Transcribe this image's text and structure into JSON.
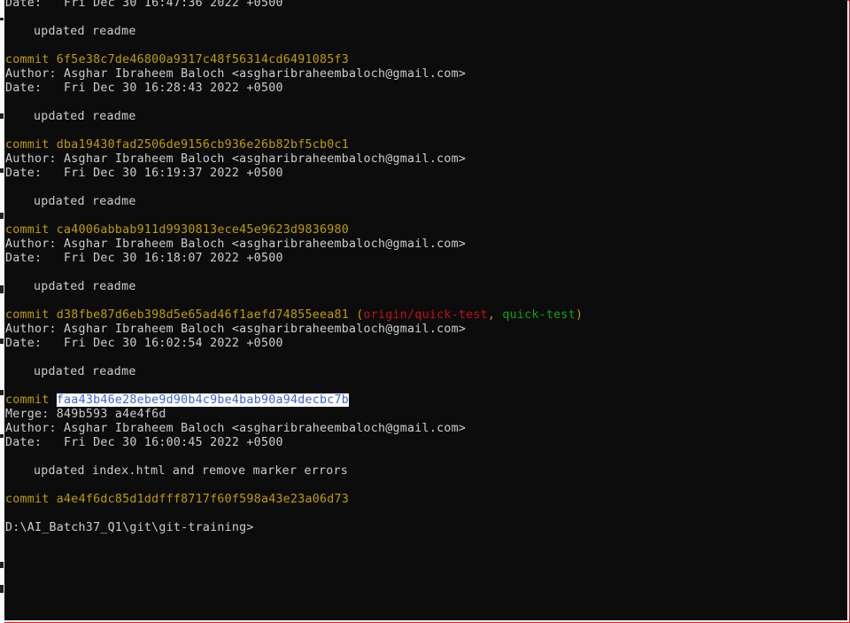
{
  "terminal": {
    "lines": [
      {
        "kind": "date",
        "label": "Date:   ",
        "value": "Fri Dec 30 16:47:36 2022 +0500"
      },
      {
        "kind": "blank"
      },
      {
        "kind": "message",
        "text": "updated readme"
      },
      {
        "kind": "blank"
      },
      {
        "kind": "commit",
        "label": "commit ",
        "hash": "6f5e38c7de46800a9317c48f56314cd6491085f3"
      },
      {
        "kind": "author",
        "label": "Author: ",
        "value": "Asghar Ibraheem Baloch <asgharibraheembaloch@gmail.com>"
      },
      {
        "kind": "date",
        "label": "Date:   ",
        "value": "Fri Dec 30 16:28:43 2022 +0500"
      },
      {
        "kind": "blank"
      },
      {
        "kind": "message",
        "text": "updated readme"
      },
      {
        "kind": "blank"
      },
      {
        "kind": "commit",
        "label": "commit ",
        "hash": "dba19430fad2506de9156cb936e26b82bf5cb0c1"
      },
      {
        "kind": "author",
        "label": "Author: ",
        "value": "Asghar Ibraheem Baloch <asgharibraheembaloch@gmail.com>"
      },
      {
        "kind": "date",
        "label": "Date:   ",
        "value": "Fri Dec 30 16:19:37 2022 +0500"
      },
      {
        "kind": "blank"
      },
      {
        "kind": "message",
        "text": "updated readme"
      },
      {
        "kind": "blank"
      },
      {
        "kind": "commit",
        "label": "commit ",
        "hash": "ca4006abbab911d9930813ece45e9623d9836980"
      },
      {
        "kind": "author",
        "label": "Author: ",
        "value": "Asghar Ibraheem Baloch <asgharibraheembaloch@gmail.com>"
      },
      {
        "kind": "date",
        "label": "Date:   ",
        "value": "Fri Dec 30 16:18:07 2022 +0500"
      },
      {
        "kind": "blank"
      },
      {
        "kind": "message",
        "text": "updated readme"
      },
      {
        "kind": "blank"
      },
      {
        "kind": "commit-refs",
        "label": "commit ",
        "hash": "d38fbe87d6eb398d5e65ad46f1aefd74855eea81",
        "open": " (",
        "ref_remote": "origin/quick-test",
        "sep": ", ",
        "ref_local": "quick-test",
        "close": ")"
      },
      {
        "kind": "author",
        "label": "Author: ",
        "value": "Asghar Ibraheem Baloch <asgharibraheembaloch@gmail.com>"
      },
      {
        "kind": "date",
        "label": "Date:   ",
        "value": "Fri Dec 30 16:02:54 2022 +0500"
      },
      {
        "kind": "blank"
      },
      {
        "kind": "message",
        "text": "updated readme"
      },
      {
        "kind": "blank"
      },
      {
        "kind": "commit-selected",
        "label": "commit ",
        "hash": "faa43b46e28ebe9d90b4c9be4bab90a94decbc7b"
      },
      {
        "kind": "merge",
        "label": "Merge: ",
        "value": "849b593 a4e4f6d"
      },
      {
        "kind": "author",
        "label": "Author: ",
        "value": "Asghar Ibraheem Baloch <asgharibraheembaloch@gmail.com>"
      },
      {
        "kind": "date",
        "label": "Date:   ",
        "value": "Fri Dec 30 16:00:45 2022 +0500"
      },
      {
        "kind": "blank"
      },
      {
        "kind": "message",
        "text": "updated index.html and remove marker errors"
      },
      {
        "kind": "blank"
      },
      {
        "kind": "commit",
        "label": "commit ",
        "hash": "a4e4f6dc85d1ddfff8717f60f598a43e23a06d73"
      },
      {
        "kind": "blank"
      },
      {
        "kind": "prompt",
        "text": "D:\\AI_Batch37_Q1\\git\\git-training>"
      }
    ]
  },
  "colors": {
    "background": "#0c0c0c",
    "foreground": "#cccccc",
    "commit": "#c19c00",
    "remote_ref": "#c50f1f",
    "local_ref": "#13a10e",
    "selection_bg": "#ffffff",
    "selection_fg": "#3a63d8",
    "frame_border": "#e81123"
  }
}
